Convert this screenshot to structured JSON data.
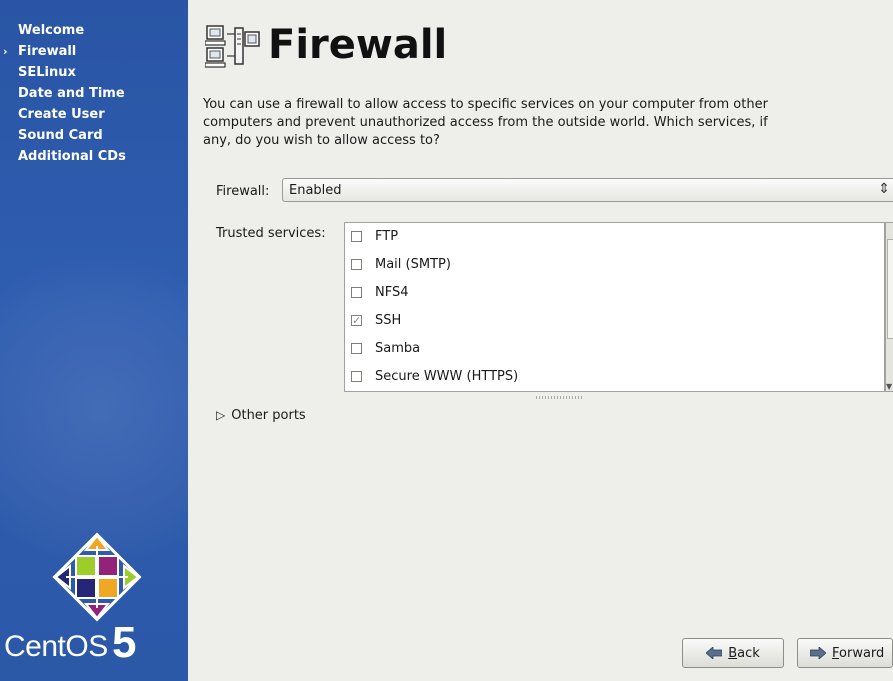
{
  "sidebar": {
    "items": [
      {
        "label": "Welcome",
        "active": false
      },
      {
        "label": "Firewall",
        "active": true
      },
      {
        "label": "SELinux",
        "active": false
      },
      {
        "label": "Date and Time",
        "active": false
      },
      {
        "label": "Create User",
        "active": false
      },
      {
        "label": "Sound Card",
        "active": false
      },
      {
        "label": "Additional CDs",
        "active": false
      }
    ],
    "brand": "CentOS",
    "brand_version": "5",
    "colors": {
      "background": "#2c58a8",
      "text": "#ffffff"
    }
  },
  "header": {
    "title": "Firewall",
    "icon": "firewall-computers-icon"
  },
  "description": "You can use a firewall to allow access to specific services on your computer from other computers and prevent unauthorized access from the outside world.  Which services, if any, do you wish to allow access to?",
  "firewall": {
    "label": "Firewall:",
    "value": "Enabled"
  },
  "trusted_services": {
    "label": "Trusted services:",
    "items": [
      {
        "label": "FTP",
        "checked": false
      },
      {
        "label": "Mail (SMTP)",
        "checked": false
      },
      {
        "label": "NFS4",
        "checked": false
      },
      {
        "label": "SSH",
        "checked": true
      },
      {
        "label": "Samba",
        "checked": false
      },
      {
        "label": "Secure WWW (HTTPS)",
        "checked": false
      }
    ]
  },
  "other_ports": {
    "label": "Other ports"
  },
  "buttons": {
    "back": {
      "mnemonic": "B",
      "rest": "ack"
    },
    "forward": {
      "mnemonic": "F",
      "rest": "orward"
    }
  }
}
